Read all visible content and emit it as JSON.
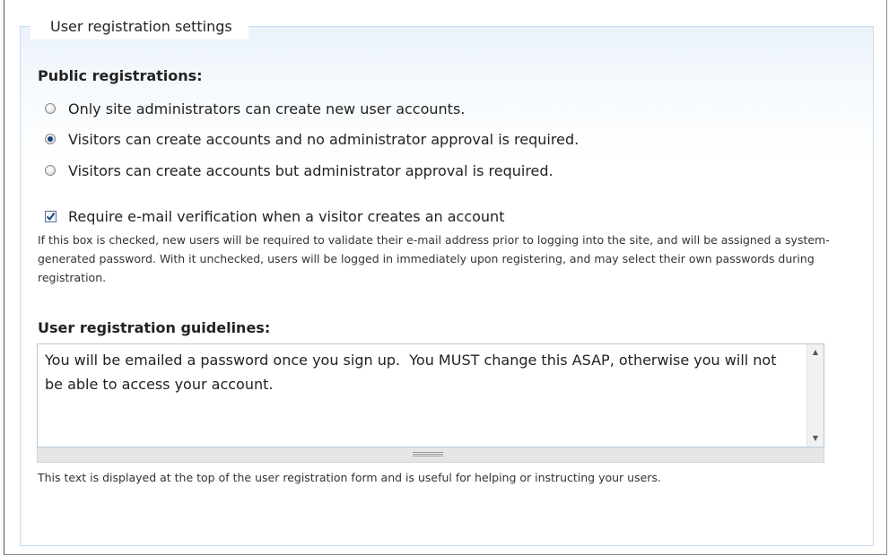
{
  "fieldset": {
    "legend": "User registration settings"
  },
  "public_registrations": {
    "heading": "Public registrations:",
    "options": [
      {
        "label": "Only site administrators can create new user accounts.",
        "checked": false
      },
      {
        "label": "Visitors can create accounts and no administrator approval is required.",
        "checked": true
      },
      {
        "label": "Visitors can create accounts but administrator approval is required.",
        "checked": false
      }
    ]
  },
  "email_verification": {
    "label": "Require e-mail verification when a visitor creates an account",
    "checked": true,
    "description": "If this box is checked, new users will be required to validate their e-mail address prior to logging into the site, and will be assigned a system-generated password. With it unchecked, users will be logged in immediately upon registering, and may select their own passwords during registration."
  },
  "guidelines": {
    "heading": "User registration guidelines:",
    "value": "You will be emailed a password once you sign up.  You MUST change this ASAP, otherwise you will not be able to access your account.",
    "description": "This text is displayed at the top of the user registration form and is useful for helping or instructing your users."
  },
  "icons": {
    "scroll_up": "scroll-up-arrow",
    "scroll_down": "scroll-down-arrow",
    "resize": "resize-grippie",
    "check": "checkmark"
  }
}
